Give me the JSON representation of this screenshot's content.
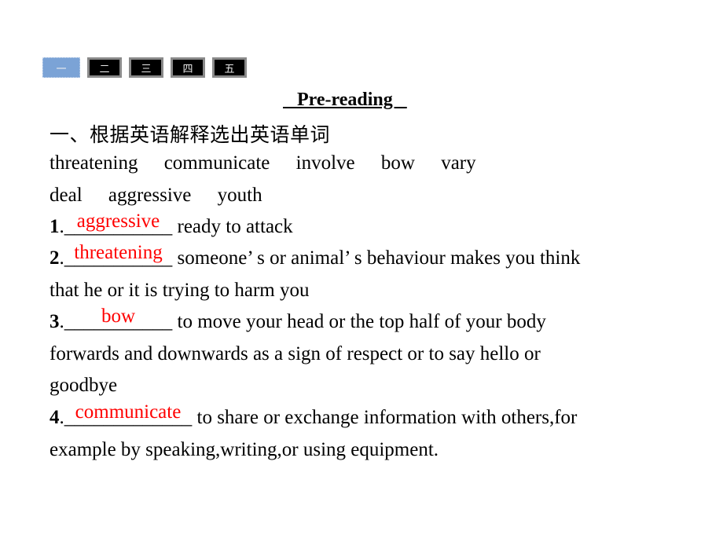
{
  "tabs": [
    {
      "label": "一",
      "active": true
    },
    {
      "label": "二",
      "active": false
    },
    {
      "label": "三",
      "active": false
    },
    {
      "label": "四",
      "active": false
    },
    {
      "label": "五",
      "active": false
    }
  ],
  "heading": "   Pre-reading   ",
  "section_title": "一、根据英语解释选出英语单词",
  "word_bank": {
    "row1": [
      "threatening",
      "communicate",
      "involve",
      "bow",
      "vary"
    ],
    "row2": [
      "deal",
      "aggressive",
      "youth"
    ]
  },
  "items": [
    {
      "number": "1",
      "blank": "___________",
      "answer": "aggressive",
      "definition_line1": " ready to attack",
      "definition_line2": "",
      "definition_line3": ""
    },
    {
      "number": "2",
      "blank": "___________",
      "answer": "threatening",
      "definition_line1": " someone’ s or animal’ s behaviour makes you think",
      "definition_line2": "that he or it is trying to harm you",
      "definition_line3": ""
    },
    {
      "number": "3",
      "blank": "___________",
      "answer": "bow",
      "definition_line1": " to move your head or the top half of your body",
      "definition_line2": "forwards and downwards as a sign of respect or to say hello or",
      "definition_line3": "goodbye"
    },
    {
      "number": "4",
      "blank": "_____________",
      "answer": "communicate",
      "definition_line1": " to share or exchange information with others,for",
      "definition_line2": "example by speaking,writing,or using equipment.",
      "definition_line3": ""
    }
  ],
  "colors": {
    "answer": "#ff0000",
    "active_tab": "#7ba3d6",
    "inactive_tab": "#000000"
  }
}
